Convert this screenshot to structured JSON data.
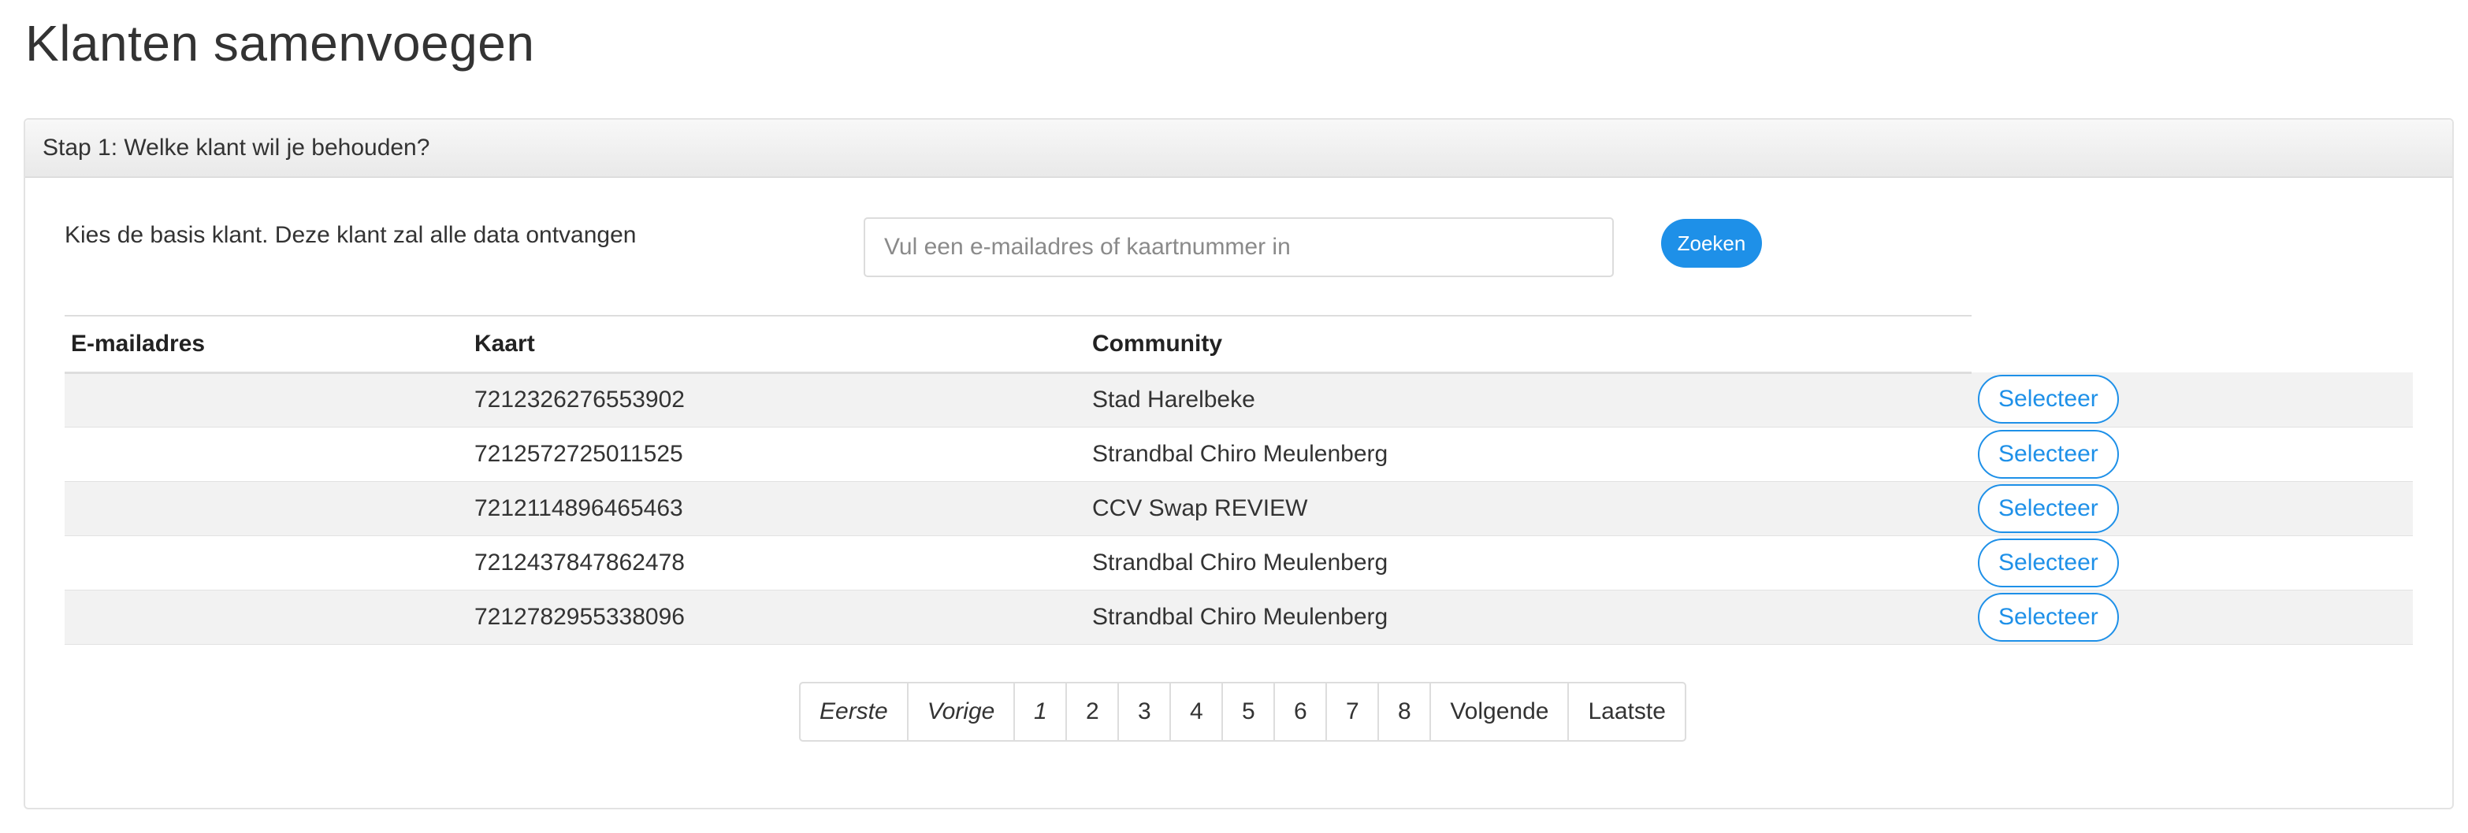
{
  "page": {
    "title": "Klanten samenvoegen"
  },
  "step1": {
    "header": "Stap 1: Welke klant wil je behouden?",
    "instruction": "Kies de basis klant. Deze klant zal alle data ontvangen",
    "search": {
      "placeholder": "Vul een e-mailadres of kaartnummer in",
      "value": "",
      "button_label": "Zoeken"
    },
    "table": {
      "columns": [
        "E-mailadres",
        "Kaart",
        "Community"
      ],
      "select_label": "Selecteer",
      "rows": [
        {
          "email": "",
          "card": "7212326276553902",
          "community": "Stad Harelbeke"
        },
        {
          "email": "",
          "card": "7212572725011525",
          "community": "Strandbal Chiro Meulenberg"
        },
        {
          "email": "",
          "card": "7212114896465463",
          "community": "CCV Swap REVIEW"
        },
        {
          "email": "",
          "card": "7212437847862478",
          "community": "Strandbal Chiro Meulenberg"
        },
        {
          "email": "",
          "card": "7212782955338096",
          "community": "Strandbal Chiro Meulenberg"
        }
      ]
    },
    "pagination": {
      "first": "Eerste",
      "previous": "Vorige",
      "current": "1",
      "pages": [
        "1",
        "2",
        "3",
        "4",
        "5",
        "6",
        "7",
        "8"
      ],
      "next": "Volgende",
      "last": "Laatste"
    }
  },
  "colors": {
    "accent": "#1e90e8",
    "row_stripe": "#f2f2f2",
    "border": "#dddddd"
  }
}
